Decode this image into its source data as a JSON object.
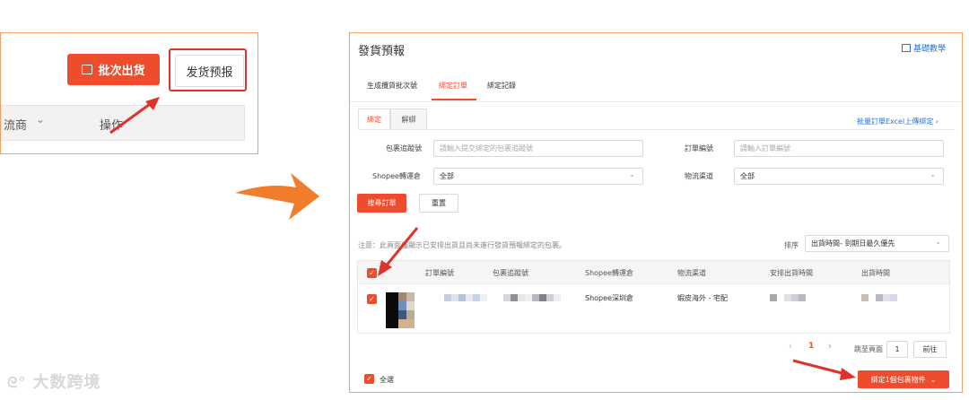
{
  "left_crop": {
    "batch_ship_label": "批次出货",
    "forecast_label": "发货预报",
    "col_logistics": "流商",
    "col_action": "操作"
  },
  "panel": {
    "title": "發貨預報",
    "help_link": "基礎教學",
    "tabs": [
      "生成攬貨批次號",
      "綁定訂單",
      "綁定記錄"
    ],
    "active_tab": 1,
    "subtabs": [
      "綁定",
      "解綁"
    ],
    "bulk_upload_link": "批量訂單Excel上傳綁定",
    "form": {
      "package_tracking_label": "包裹追蹤號",
      "package_tracking_placeholder": "請輸入提交綁定的包裹追蹤號",
      "order_no_label": "訂單編號",
      "order_no_placeholder": "請輸入訂單編號",
      "warehouse_label": "Shopee轉運倉",
      "warehouse_value": "全部",
      "channel_label": "物流渠道",
      "channel_value": "全部"
    },
    "search_button": "搜尋訂單",
    "reset_button": "重置",
    "notice": "注意：此頁面僅顯示已安排出貨且尚未進行發貨預報綁定的包裹。",
    "sort_label": "排序",
    "sort_value": "出貨時間- 到期日最久優先",
    "table": {
      "headers": [
        "訂單編號",
        "包裹追蹤號",
        "Shopee轉運倉",
        "物流渠道",
        "安排出貨時間",
        "出貨時間"
      ],
      "row": {
        "warehouse": "Shopee深圳倉",
        "channel": "蝦皮海外 - 宅配"
      }
    },
    "pagination": {
      "prev": "‹",
      "current": "1",
      "next": "›",
      "goto_label": "跳至頁面",
      "goto_value": "1",
      "go_button": "前往"
    },
    "select_all_label": "全選",
    "bind_button": "綁定1個包裹物件"
  },
  "watermark": "大数跨境",
  "colors": {
    "accent": "#ee4d2d",
    "arrow": "#f07d2a",
    "annotation_red": "#e0312b",
    "link_blue": "#2673dd"
  }
}
